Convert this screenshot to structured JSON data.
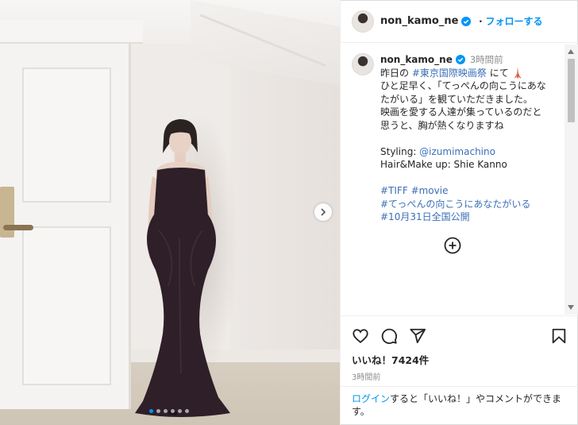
{
  "post": {
    "username": "non_kamo_ne",
    "follow_label": "フォローする",
    "separator": "・"
  },
  "caption": {
    "username": "non_kamo_ne",
    "time_ago": "3時間前",
    "line1_prefix": "昨日の ",
    "line1_tag": "#東京国際映画祭",
    "line1_suffix": " にて 🗼",
    "line2": "ひと足早く、「てっぺんの向こうにあな",
    "line3": "たがいる」を観ていただきました。",
    "line4": "映画を愛する人達が集っているのだと",
    "line5": "思うと、胸が熱くなりますね",
    "styling_prefix": "Styling: ",
    "styling_mention": "@izumimachino",
    "hair": "Hair&Make up: Shie Kanno",
    "tag1": "#TIFF",
    "tag2": "#movie",
    "tag3": "#てっぺんの向こうにあなたがいる",
    "tag4": "#10月31日全国公開"
  },
  "icons": {
    "like": "heart-icon",
    "comment": "comment-icon",
    "share": "paper-plane-icon",
    "save": "bookmark-icon",
    "verified": "verified-badge-icon",
    "load_more": "plus-circle-icon",
    "next": "chevron-right-icon"
  },
  "engagement": {
    "likes": "いいね！7424件",
    "time": "3時間前"
  },
  "login_prompt": {
    "link": "ログイン",
    "text": "すると「いいね！」やコメントができます。"
  },
  "carousel": {
    "dot_count": 6,
    "active_index": 0
  },
  "colors": {
    "link": "#0095f6",
    "verified": "#0095f6",
    "hashtag": "#3b6fb7",
    "dress": "#2e1f28"
  }
}
